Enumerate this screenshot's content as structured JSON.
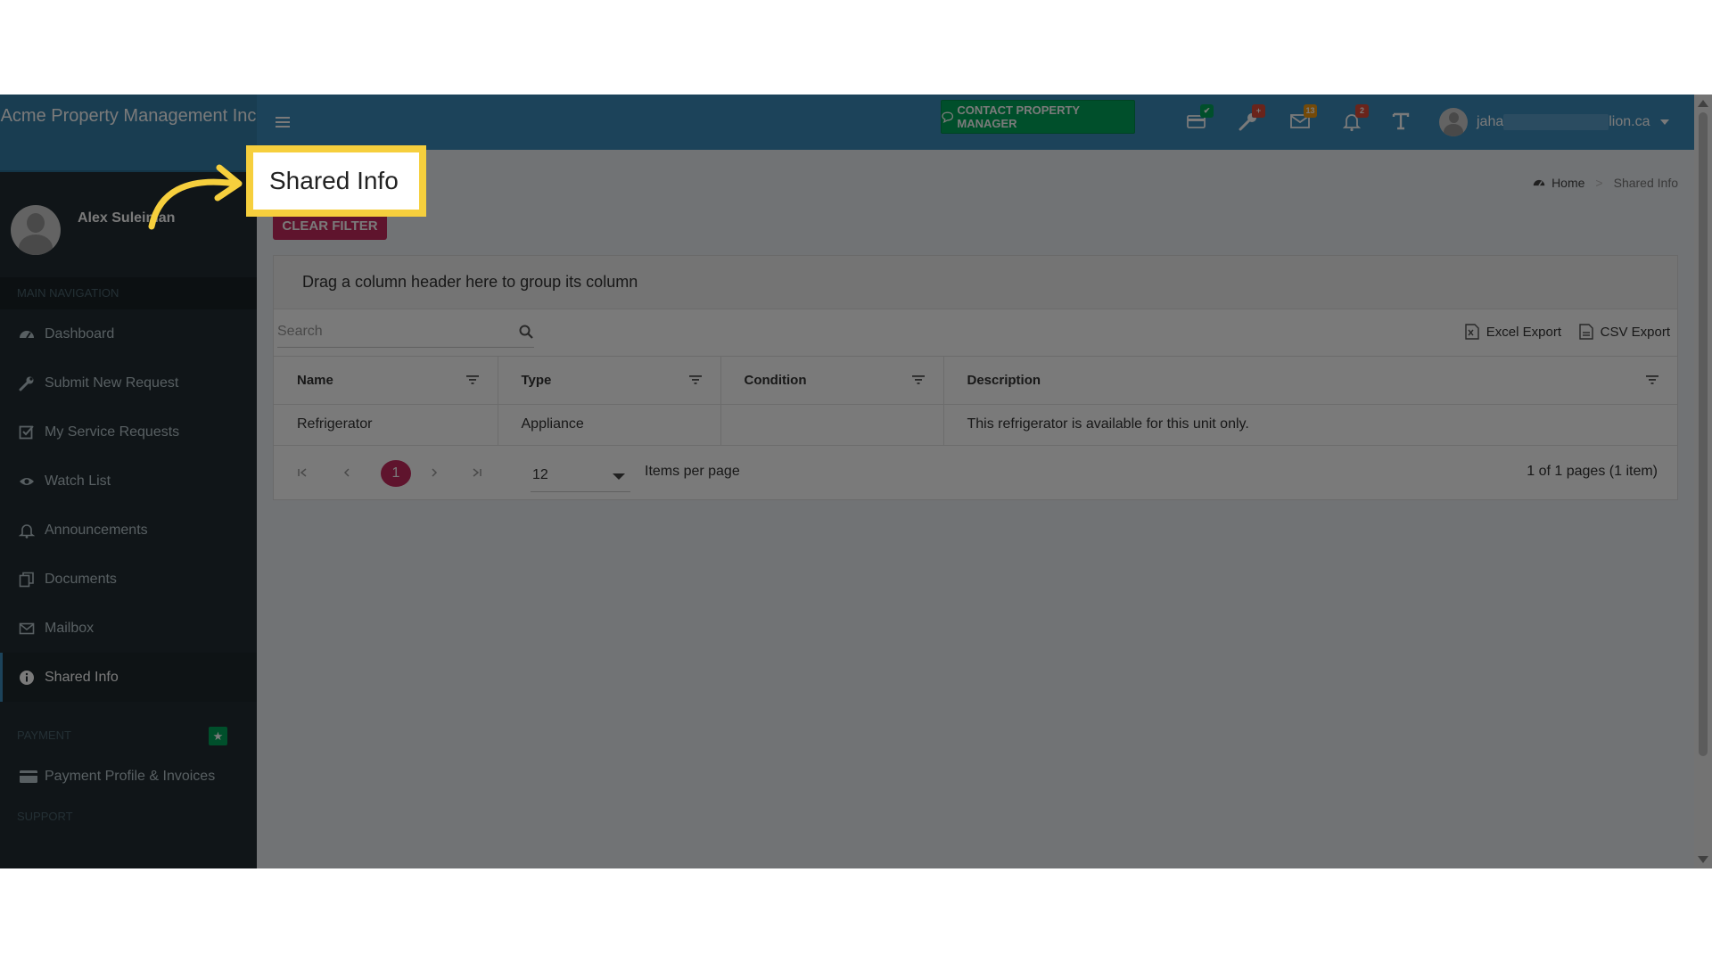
{
  "brand": {
    "name": "Acme Property Management Inc"
  },
  "user": {
    "name": "Alex Suleiman",
    "email_prefix": "jaha",
    "email_suffix": "lion.ca"
  },
  "sidebar": {
    "main_header": "MAIN NAVIGATION",
    "items": [
      {
        "label": "Dashboard",
        "icon": "dashboard-icon"
      },
      {
        "label": "Submit New Request",
        "icon": "wrench-icon"
      },
      {
        "label": "My Service Requests",
        "icon": "checkbox-icon"
      },
      {
        "label": "Watch List",
        "icon": "eye-icon"
      },
      {
        "label": "Announcements",
        "icon": "bell-icon"
      },
      {
        "label": "Documents",
        "icon": "documents-icon"
      },
      {
        "label": "Mailbox",
        "icon": "envelope-icon"
      },
      {
        "label": "Shared Info",
        "icon": "info-icon"
      }
    ],
    "payment_header": "PAYMENT",
    "payment_items": [
      {
        "label": "Payment Profile & Invoices",
        "icon": "credit-card-icon"
      }
    ],
    "support_header": "SUPPORT"
  },
  "navbar": {
    "contact_label": "CONTACT PROPERTY MANAGER",
    "badges": {
      "mail": "13",
      "bell": "2"
    }
  },
  "breadcrumb": {
    "home": "Home",
    "current": "Shared Info"
  },
  "toolbar": {
    "clear_filter": "CLEAR FILTER"
  },
  "grid": {
    "group_hint": "Drag a column header here to group its column",
    "search_placeholder": "Search",
    "excel_export": "Excel Export",
    "csv_export": "CSV Export",
    "columns": [
      "Name",
      "Type",
      "Condition",
      "Description"
    ],
    "rows": [
      {
        "name": "Refrigerator",
        "type": "Appliance",
        "condition": "",
        "description": "This refrigerator is available for this unit only."
      }
    ]
  },
  "pager": {
    "current_page": "1",
    "page_size": "12",
    "items_per_page_label": "Items per page",
    "info": "1 of 1 pages (1 item)"
  },
  "callout": {
    "text": "Shared Info"
  },
  "colors": {
    "accent": "#c62b5f",
    "navbar": "#3c8dbc",
    "sidebar": "#222d32",
    "success": "#00a65a",
    "highlight": "#f6cf3d"
  }
}
